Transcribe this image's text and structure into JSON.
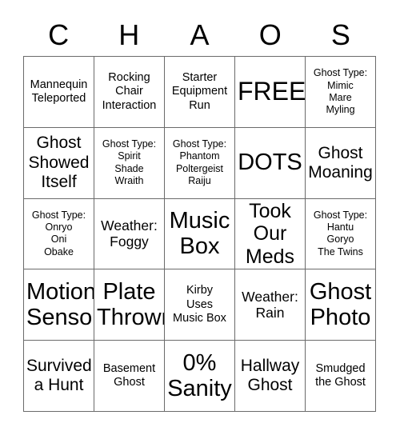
{
  "card": {
    "title_letters": [
      "C",
      "H",
      "A",
      "O",
      "S"
    ],
    "grid_size": "5x5",
    "border_color": "#6b6b6b",
    "text_color": "#000000",
    "background_color": "#ffffff"
  },
  "cells": [
    {
      "text": "Mannequin\nTeleported",
      "size": "fs-sm"
    },
    {
      "text": "Rocking\nChair\nInteraction",
      "size": "fs-sm"
    },
    {
      "text": "Starter\nEquipment\nRun",
      "size": "fs-sm"
    },
    {
      "text": "FREE",
      "size": "fs-free"
    },
    {
      "text": "Ghost Type:\nMimic\nMare\nMyling",
      "size": "fs-xs"
    },
    {
      "text": "Ghost\nShowed\nItself",
      "size": "fs-lg"
    },
    {
      "text": "Ghost Type:\nSpirit\nShade\nWraith",
      "size": "fs-xs"
    },
    {
      "text": "Ghost Type:\nPhantom\nPoltergeist\nRaiju",
      "size": "fs-xs"
    },
    {
      "text": "DOTS",
      "size": "fs-xxl"
    },
    {
      "text": "Ghost\nMoaning",
      "size": "fs-lg"
    },
    {
      "text": "Ghost Type:\nOnryo\nOni\nObake",
      "size": "fs-xs"
    },
    {
      "text": "Weather:\nFoggy",
      "size": "fs-md"
    },
    {
      "text": "Music\nBox",
      "size": "fs-xxl"
    },
    {
      "text": "Took\nOur\nMeds",
      "size": "fs-xl"
    },
    {
      "text": "Ghost Type:\nHantu\nGoryo\nThe Twins",
      "size": "fs-xs"
    },
    {
      "text": "Motion\nSensor",
      "size": "fs-xxl"
    },
    {
      "text": "Plate\nThrown",
      "size": "fs-xxl"
    },
    {
      "text": "Kirby\nUses\nMusic Box",
      "size": "fs-sm"
    },
    {
      "text": "Weather:\nRain",
      "size": "fs-md"
    },
    {
      "text": "Ghost\nPhoto",
      "size": "fs-xxl"
    },
    {
      "text": "Survived\na Hunt",
      "size": "fs-lg"
    },
    {
      "text": "Basement\nGhost",
      "size": "fs-sm"
    },
    {
      "text": "0%\nSanity",
      "size": "fs-xxl"
    },
    {
      "text": "Hallway\nGhost",
      "size": "fs-lg"
    },
    {
      "text": "Smudged\nthe Ghost",
      "size": "fs-sm"
    }
  ]
}
